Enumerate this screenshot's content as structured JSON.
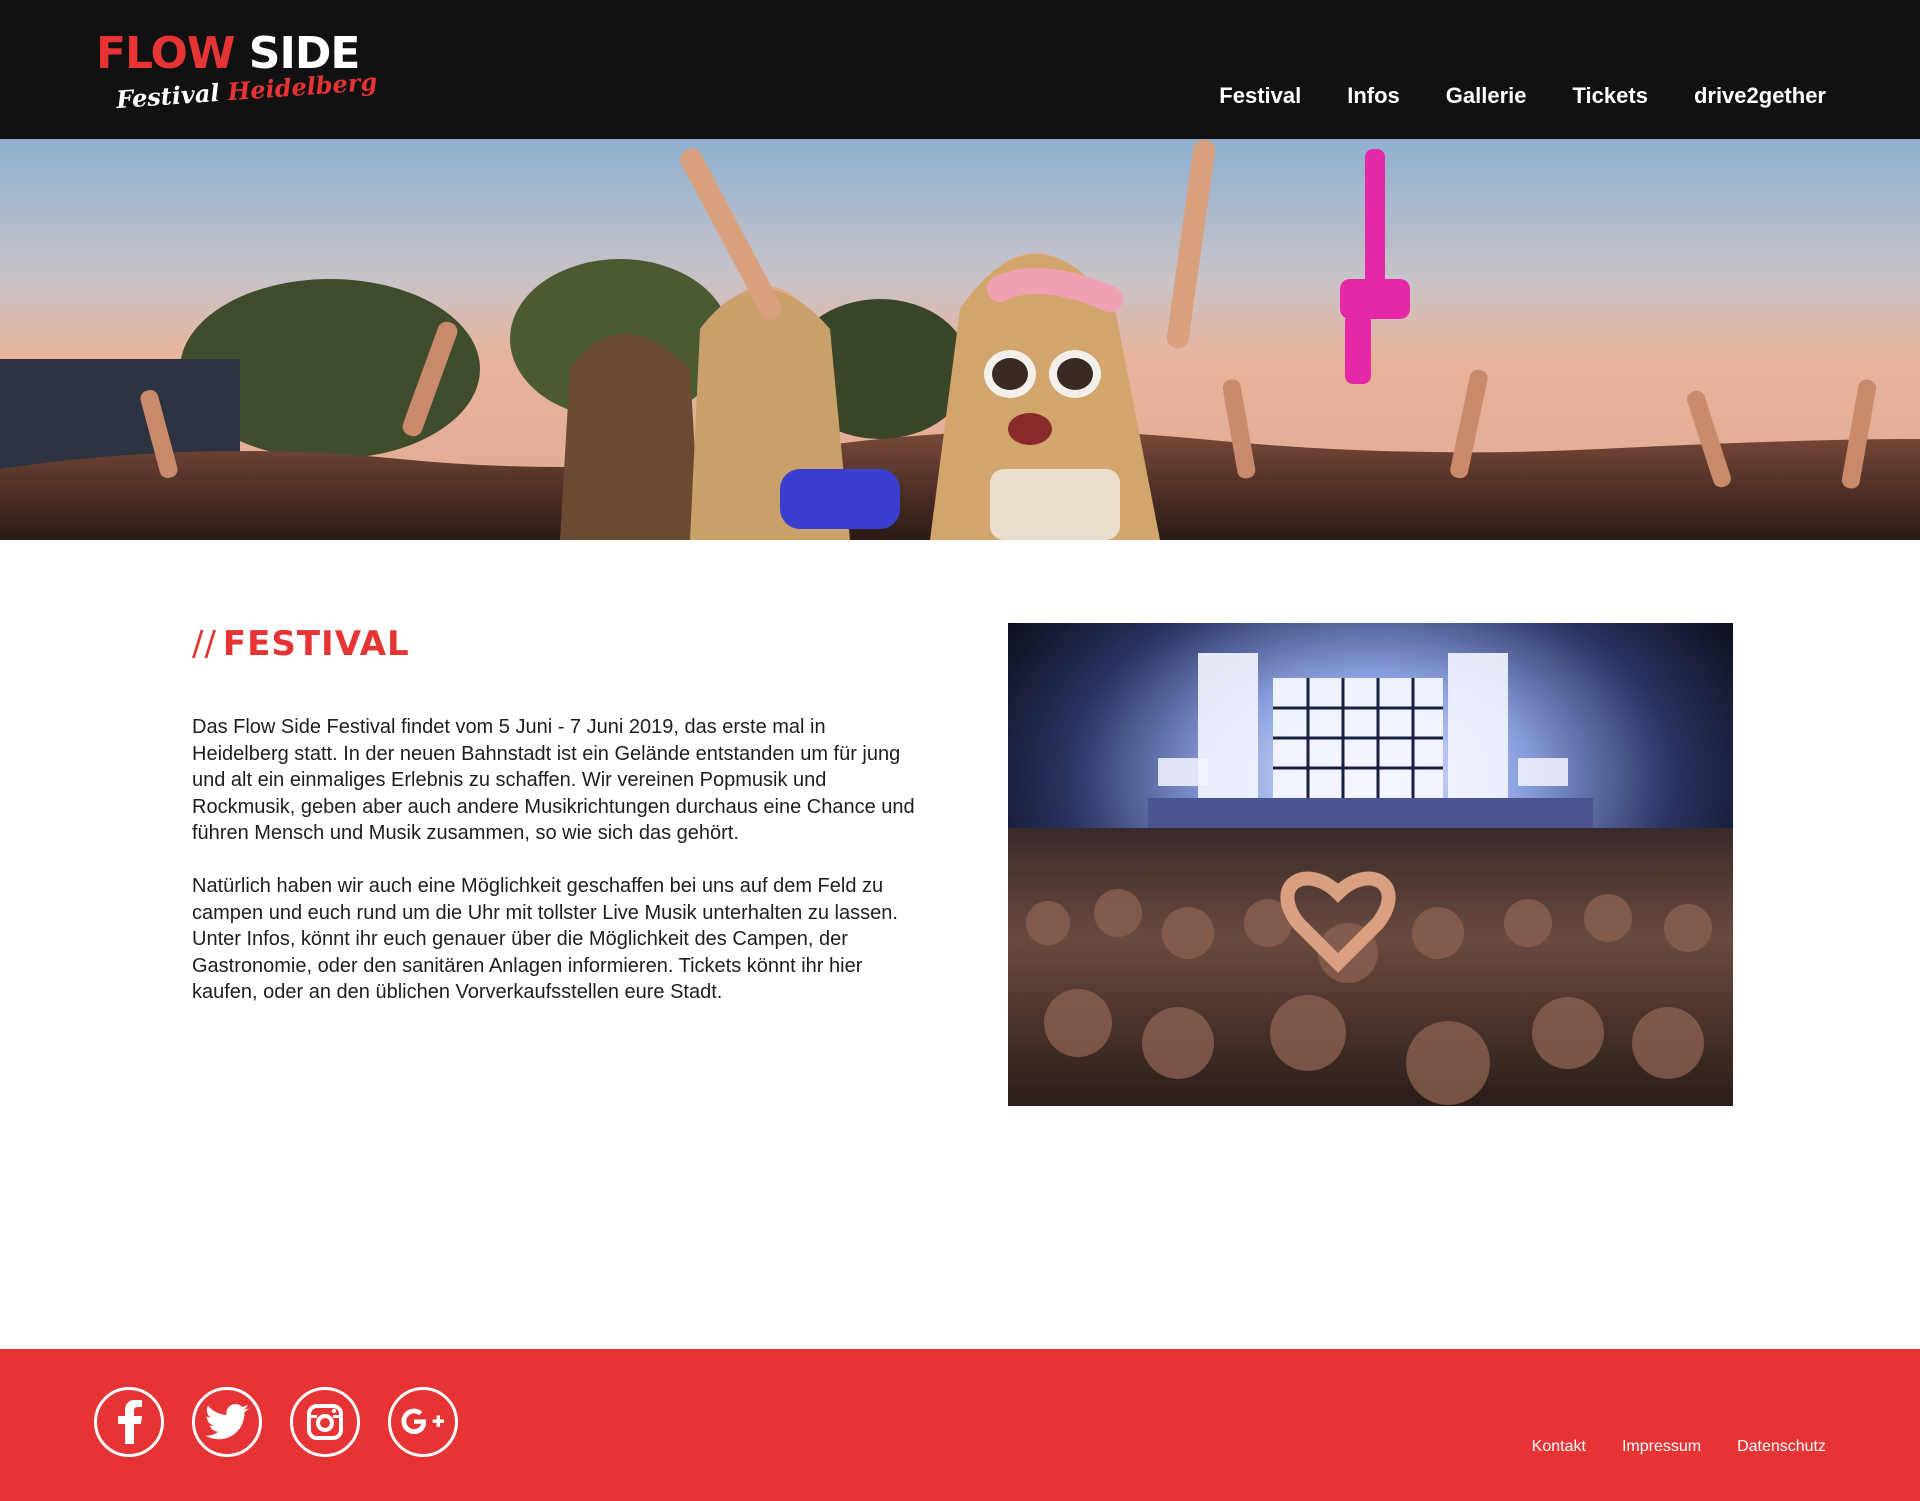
{
  "header": {
    "logo": {
      "word1": "FLOW",
      "word2": "SIDE",
      "sub1": "Festival",
      "sub2": "Heidelberg"
    },
    "nav": [
      {
        "label": "Festival"
      },
      {
        "label": "Infos"
      },
      {
        "label": "Gallerie"
      },
      {
        "label": "Tickets"
      },
      {
        "label": "drive2gether"
      }
    ]
  },
  "main": {
    "section_slashes": "//",
    "section_title": "FESTIVAL",
    "paragraphs": [
      "Das Flow Side Festival findet vom 5 Juni - 7 Juni 2019, das erste mal in Heidelberg statt. In der neuen Bahnstadt ist ein Gelände entstanden um für jung und alt ein einmaliges Erlebnis zu schaffen. Wir vereinen Popmusik und Rockmusik, geben aber auch andere Musikrichtungen durchaus eine Chance und führen Mensch und Musik zusammen, so wie sich das gehört.",
      "Natürlich haben wir auch eine Möglichkeit geschaffen bei uns auf dem Feld zu campen und euch rund um die Uhr mit tollster Live Musik unterhalten zu lassen. Unter Infos, könnt ihr euch genauer über die Möglichkeit des Campen, der Gastronomie, oder den sanitären Anlagen informieren. Tickets könnt ihr hier kaufen, oder an den üblichen Vorverkaufsstellen eure Stadt."
    ]
  },
  "footer": {
    "socials": [
      {
        "icon": "facebook-icon"
      },
      {
        "icon": "twitter-icon"
      },
      {
        "icon": "instagram-icon"
      },
      {
        "icon": "google-plus-icon"
      }
    ],
    "links": [
      {
        "label": "Kontakt"
      },
      {
        "label": "Impressum"
      },
      {
        "label": "Datenschutz"
      }
    ]
  },
  "colors": {
    "header_bg": "#111111",
    "accent_red": "#e63434",
    "text": "#1e1e1e",
    "white": "#ffffff"
  }
}
